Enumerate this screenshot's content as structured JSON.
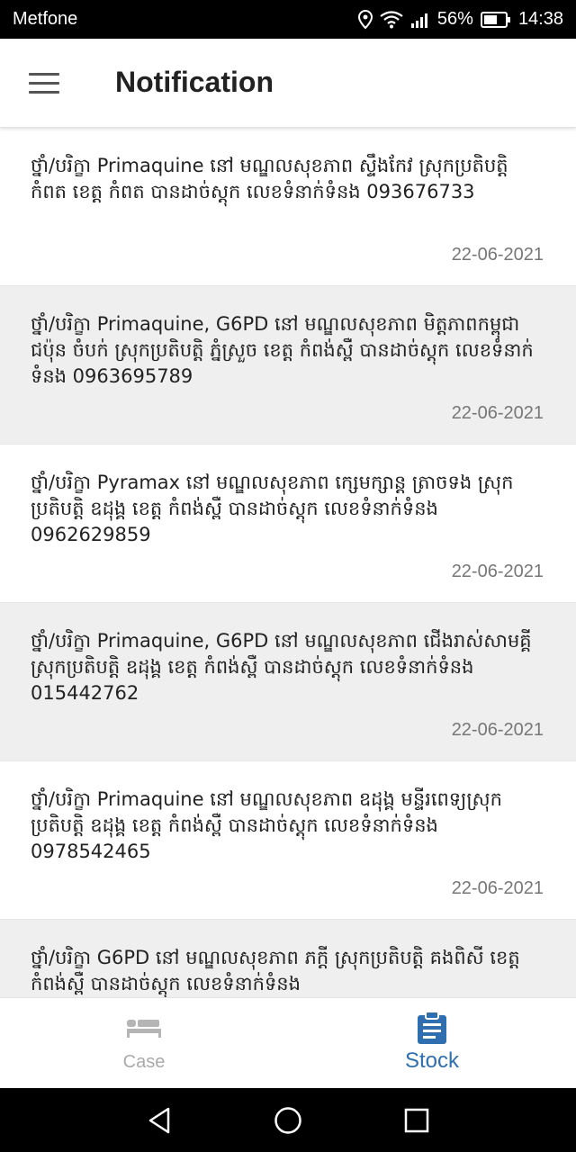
{
  "status_bar": {
    "carrier": "Metfone",
    "battery": "56%",
    "time": "14:38"
  },
  "header": {
    "title": "Notification",
    "menu_icon": "menu-icon"
  },
  "notifications": [
    {
      "message": "ថ្នាំ/បរិក្ខា Primaquine នៅ  មណ្ឌលសុខភាព ស្ទឹងកែវ ស្រុកប្រតិបត្តិ កំពត ខេត្ត កំពត បានដាច់ស្តុក លេខទំនាក់ទំនង 093676733",
      "date": "22-06-2021"
    },
    {
      "message": "ថ្នាំ/បរិក្ខា Primaquine, G6PD នៅ  មណ្ឌលសុខភាព មិត្តភាពកម្ពុជាជប៉ុន ចំបក់ ស្រុកប្រតិបត្តិ ភ្នំស្រួច ខេត្ត កំពង់ស្ពឺ បានដាច់ស្តុក លេខទំនាក់ទំនង 0963695789",
      "date": "22-06-2021"
    },
    {
      "message": "ថ្នាំ/បរិក្ខា Pyramax នៅ  មណ្ឌលសុខភាព ក្សេមក្សាន្ត ត្រាចទង ស្រុកប្រតិបត្តិ ឧដុង្គ ខេត្ត កំពង់ស្ពឺ បានដាច់ស្តុក លេខទំនាក់ទំនង 0962629859",
      "date": "22-06-2021"
    },
    {
      "message": "ថ្នាំ/បរិក្ខា Primaquine, G6PD នៅ  មណ្ឌលសុខភាព ជើងរាស់សាមគ្គី ស្រុកប្រតិបត្តិ ឧដុង្គ ខេត្ត កំពង់ស្ពឺ បានដាច់ស្តុក លេខទំនាក់ទំនង 015442762",
      "date": "22-06-2021"
    },
    {
      "message": "ថ្នាំ/បរិក្ខា Primaquine នៅ  មណ្ឌលសុខភាព ឧដុង្គ មន្ទីរពេទ្យស្រុកប្រតិបត្តិ ឧដុង្គ ខេត្ត កំពង់ស្ពឺ បានដាច់ស្តុក លេខទំនាក់ទំនង 0978542465",
      "date": "22-06-2021"
    },
    {
      "message": "ថ្នាំ/បរិក្ខា G6PD នៅ  មណ្ឌលសុខភាព ភក្តី ស្រុកប្រតិបត្តិ គងពិសី ខេត្ត កំពង់ស្ពឺ បានដាច់ស្តុក លេខទំនាក់ទំនង",
      "date": ""
    }
  ],
  "bottom_nav": {
    "items": [
      {
        "label": "Case",
        "icon": "bed-icon",
        "active": false
      },
      {
        "label": "Stock",
        "icon": "clipboard-icon",
        "active": true
      }
    ],
    "active_color": "#2f6fb0",
    "inactive_color": "#aaaaaa"
  },
  "system_nav": {
    "icons": [
      "back-icon",
      "home-icon",
      "recents-icon"
    ]
  }
}
